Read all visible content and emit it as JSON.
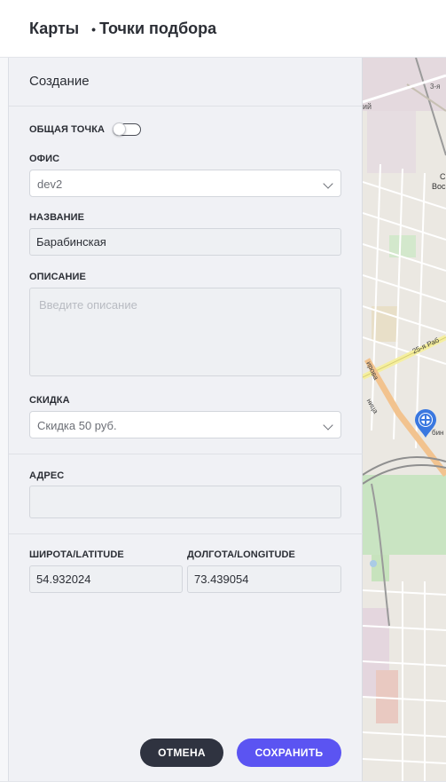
{
  "header": {
    "title": "Карты",
    "separator": "•",
    "subtitle": "Точки подбора"
  },
  "form": {
    "title": "Создание",
    "common_point_label": "ОБЩАЯ ТОЧКА",
    "common_point_on": false,
    "office_label": "ОФИС",
    "office_value": "dev2",
    "name_label": "НАЗВАНИЕ",
    "name_value": "Барабинская",
    "description_label": "ОПИСАНИЕ",
    "description_placeholder": "Введите описание",
    "discount_label": "СКИДКА",
    "discount_value": "Скидка 50 руб.",
    "address_label": "АДРЕС",
    "address_value": "",
    "latitude_label": "ШИРОТА/LATITUDE",
    "latitude_value": "54.932024",
    "longitude_label": "ДОЛГОТА/LONGITUDE",
    "longitude_value": "73.439054"
  },
  "buttons": {
    "cancel_label": "ОТМЕНА",
    "save_label": "СОХРАНИТЬ"
  },
  "map": {
    "labels": [
      "3-я",
      "ий",
      "С",
      "Вос",
      "25-я Раб",
      "ирова",
      "ница",
      "бин"
    ],
    "marker_icon": "crosshair-pin-icon"
  },
  "colors": {
    "accent": "#5b54f2",
    "cancel": "#2f3340",
    "marker": "#3a78e0"
  }
}
